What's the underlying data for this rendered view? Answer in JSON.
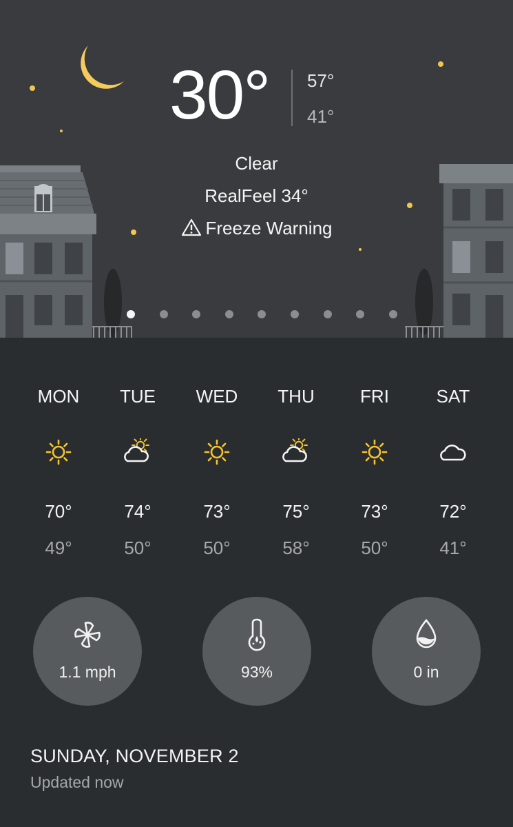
{
  "current": {
    "temp": "30°",
    "high": "57°",
    "low": "41°",
    "condition": "Clear",
    "realfeel": "RealFeel 34°",
    "alert": "Freeze Warning"
  },
  "pager": {
    "page_count": 9,
    "active_index": 0
  },
  "forecast": [
    {
      "day": "MON",
      "icon": "sun-icon",
      "high": "70°",
      "low": "49°"
    },
    {
      "day": "TUE",
      "icon": "partly-cloudy-icon",
      "high": "74°",
      "low": "50°"
    },
    {
      "day": "WED",
      "icon": "sun-icon",
      "high": "73°",
      "low": "50°"
    },
    {
      "day": "THU",
      "icon": "partly-cloudy-icon",
      "high": "75°",
      "low": "58°"
    },
    {
      "day": "FRI",
      "icon": "sun-icon",
      "high": "73°",
      "low": "50°"
    },
    {
      "day": "SAT",
      "icon": "cloud-icon",
      "high": "72°",
      "low": "41°"
    }
  ],
  "stats": {
    "wind": {
      "icon": "wind-icon",
      "value": "1.1 mph"
    },
    "humidity": {
      "icon": "humidity-icon",
      "value": "93%"
    },
    "precipitation": {
      "icon": "precipitation-icon",
      "value": "0 in"
    }
  },
  "footer": {
    "date": "SUNDAY, NOVEMBER 2",
    "updated": "Updated now"
  },
  "colors": {
    "background": "#2a2d30",
    "hero_sky": "#393b3e",
    "accent_sun": "#f7c52b",
    "stat_circle": "#585b5d"
  }
}
